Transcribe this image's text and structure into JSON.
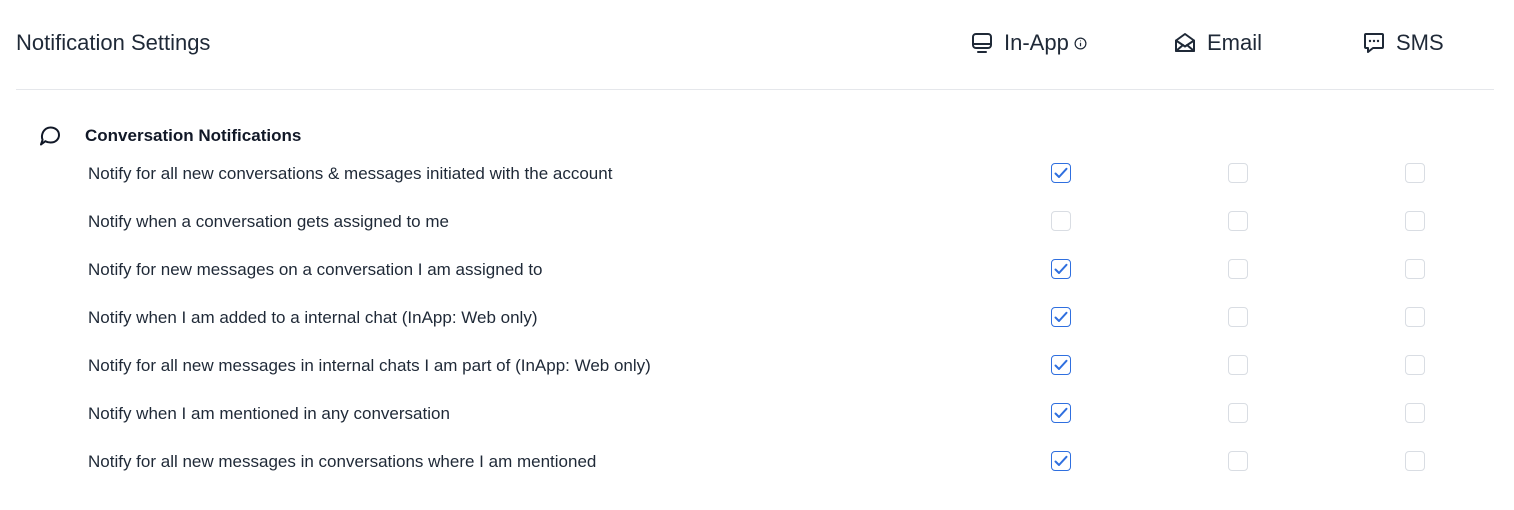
{
  "header": {
    "title": "Notification Settings",
    "channels": [
      {
        "key": "in_app",
        "label": "In-App",
        "icon": "monitor-icon",
        "has_info": true
      },
      {
        "key": "email",
        "label": "Email",
        "icon": "envelope-open-icon",
        "has_info": false
      },
      {
        "key": "sms",
        "label": "SMS",
        "icon": "chat-bubble-dots-icon",
        "has_info": false
      }
    ]
  },
  "section": {
    "title": "Conversation Notifications",
    "icon": "speech-bubble-icon",
    "rows": [
      {
        "label": "Notify for all new conversations & messages initiated with the account",
        "in_app": true,
        "email": false,
        "sms": false
      },
      {
        "label": "Notify when a conversation gets assigned to me",
        "in_app": false,
        "email": false,
        "sms": false
      },
      {
        "label": "Notify for new messages on a conversation I am assigned to",
        "in_app": true,
        "email": false,
        "sms": false
      },
      {
        "label": "Notify when I am added to a internal chat (InApp: Web only)",
        "in_app": true,
        "email": false,
        "sms": false
      },
      {
        "label": "Notify for all new messages in internal chats I am part of (InApp: Web only)",
        "in_app": true,
        "email": false,
        "sms": false
      },
      {
        "label": "Notify when I am mentioned in any conversation",
        "in_app": true,
        "email": false,
        "sms": false
      },
      {
        "label": "Notify for all new messages in conversations where I am mentioned",
        "in_app": true,
        "email": false,
        "sms": false
      }
    ]
  },
  "colors": {
    "accent": "#2f6fdf",
    "checkbox_border": "#d9dde3",
    "divider": "#e5e7eb"
  }
}
